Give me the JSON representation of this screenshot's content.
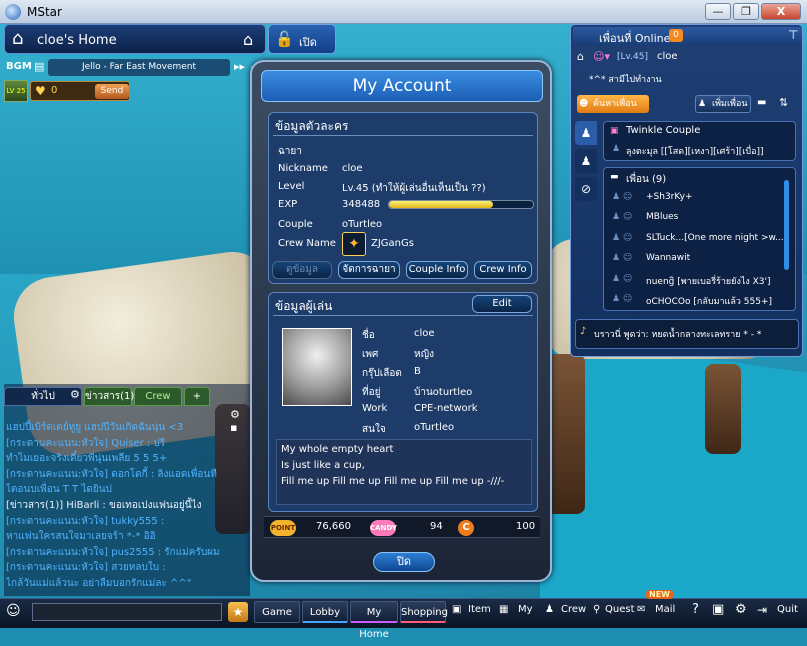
{
  "window": {
    "title": "MStar",
    "btn_min": "—",
    "btn_max": "❐",
    "btn_close": "X"
  },
  "room": {
    "name": "cloe's Home",
    "lock_label": "เปิด"
  },
  "bgm": {
    "label": "BGM",
    "song": "Jello - Far East Movement"
  },
  "send": {
    "avatar_level": "LV 25",
    "hearts": "0",
    "send_label": "Send"
  },
  "chat": {
    "tabs": [
      "ทั่วไป",
      "ข่าวสาร(1)",
      "Crew",
      "+"
    ],
    "lines": [
      {
        "text": "แฮปปี้เบิร์ดเดย์ทูยู  แฮปปีวันเกิดฉันนุ่น <3",
        "color": "#4fb3ff"
      },
      {
        "text": "[กระดานคะแนน:หัวใจ] Quiser  : ปรี",
        "color": "#4fb3ff"
      },
      {
        "text": "ทำไมเยอะจริงเดี๋ยวพี่นุ่นเพลีย 5 5 5+",
        "color": "#4fb3ff"
      },
      {
        "text": "[กระดานคะแนน:หัวใจ] ดอกโดกี้  : ลิงแอดเพื่อนที",
        "color": "#4fb3ff"
      },
      {
        "text": "ไดอนบเพื่อน T T ไดยินป",
        "color": "#4fb3ff"
      },
      {
        "text": "[ข่าวสาร(1)] HiBarli  : ขอเทอเปงแฟนอยู่นี้ไง",
        "color": "#e9f2ff"
      },
      {
        "text": "[กระดานคะแนน:หัวใจ] tukky555  :",
        "color": "#4fb3ff"
      },
      {
        "text": "หาแฟนใครสนใจมาเลยจร้า *-* อิอิ",
        "color": "#4fb3ff"
      },
      {
        "text": "[กระดานคะแนน:หัวใจ] pus2555  : รักแม่ครับผม",
        "color": "#4fb3ff"
      },
      {
        "text": "[กระดานคะแนน:หัวใจ] สวยหลบใบ  :",
        "color": "#4fb3ff"
      },
      {
        "text": "ไกล้วันแม่แล้วนะ อย่าลืมบอกรักแม่ละ ^^\"",
        "color": "#4fb3ff"
      }
    ]
  },
  "bottom": {
    "tabs": [
      "Game",
      "Lobby",
      "My Home",
      "Shopping"
    ],
    "items": [
      "Item",
      "My",
      "Crew",
      "Quest",
      "Mail",
      "Quit"
    ],
    "new_badge": "NEW"
  },
  "dialog": {
    "title": "My Account",
    "char_section": "ข้อมูลตัวละคร",
    "char_sub": "ฉายา",
    "fields": [
      {
        "label": "Nickname",
        "value": "cloe"
      },
      {
        "label": "Level",
        "value": "Lv.45 (ทำให้ผู้เล่นอื่นเห็นเป็น ??)"
      },
      {
        "label": "EXP",
        "value": "348488"
      },
      {
        "label": "Couple",
        "value": "oTurtleo"
      },
      {
        "label": "Crew Name",
        "value": "ZJGanGs"
      }
    ],
    "exp_fraction": 0.72,
    "buttons": [
      "ดูข้อมูล",
      "จัดการฉายา",
      "Couple Info",
      "Crew Info"
    ],
    "player_section": "ข้อมูลผู้เล่น",
    "edit_label": "Edit",
    "player_fields": [
      {
        "label": "ชื่อ",
        "value": "cloe"
      },
      {
        "label": "เพศ",
        "value": "หญิง"
      },
      {
        "label": "กรุ๊ปเลือด",
        "value": "B"
      },
      {
        "label": "ที่อยู่",
        "value": "บ้านoturtleo"
      },
      {
        "label": "Work",
        "value": "CPE-network"
      },
      {
        "label": "สนใจ",
        "value": "oTurtleo"
      }
    ],
    "message": [
      "My whole empty heart",
      "Is just like a cup,",
      "Fill me up Fill me up Fill me up Fill me up -///-"
    ],
    "point_label": "POINT",
    "points": "76,660",
    "candy_label": "CANDY",
    "candy": "94",
    "coins": "100",
    "close_label": "ปิด"
  },
  "friends": {
    "title": "เพื่อนที่ Online",
    "count": "0",
    "me_level": "[Lv.45]",
    "me_name": "cloe",
    "status_text": "*^* สามีไปทำงาน",
    "search_label": "ค้นหาเพื่อน",
    "add_label": "เพิ่มเพื่อน",
    "couple_group": "Twinkle Couple",
    "couple_member": "ลุงตะมุล [[โสด][เหงา][เศร้า][เบื่อ]]",
    "friend_group": "เพื่อน (9)",
    "list": [
      "+Sh3rKy+",
      "MBlues",
      "SLTuck...[One more night >w...]",
      "Wannawit",
      "nuengิ [พายเบอรี่ร้ายยังไง X3']",
      "oCHOCOo [กลับมาแล้ว 555+]"
    ],
    "ticker": "บราวนี่ พูดว่า: หยดน้ำกลางทะเลทราย * - *"
  }
}
